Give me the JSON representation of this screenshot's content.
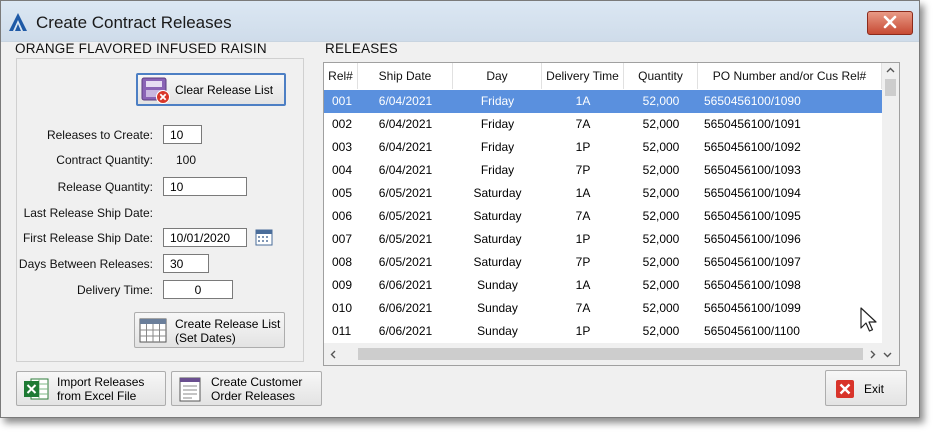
{
  "window": {
    "title": "Create Contract Releases",
    "colors": {
      "title_bg": "#d6e2ef",
      "close": "#c74a33",
      "selection": "#5a90de"
    }
  },
  "product": {
    "name": "ORANGE FLAVORED INFUSED RAISIN"
  },
  "left": {
    "clear_button": "Clear Release List",
    "fields": {
      "releases_to_create": {
        "label": "Releases to Create:",
        "value": "10"
      },
      "contract_quantity": {
        "label": "Contract Quantity:",
        "value": "100"
      },
      "release_quantity": {
        "label": "Release Quantity:",
        "value": "10"
      },
      "last_release_ship_date": {
        "label": "Last Release Ship Date:"
      },
      "first_release_ship_date": {
        "label": "First Release Ship Date:",
        "value": "10/01/2020"
      },
      "days_between_releases": {
        "label": "Days Between Releases:",
        "value": "30"
      },
      "delivery_time": {
        "label": "Delivery Time:",
        "value": "0"
      }
    },
    "create_release_button": {
      "line1": "Create Release List",
      "line2": "(Set Dates)"
    }
  },
  "releases": {
    "label": "RELEASES",
    "columns": [
      "Rel#",
      "Ship Date",
      "Day",
      "Delivery Time",
      "Quantity",
      "PO Number and/or Cus Rel#"
    ],
    "rows": [
      [
        "001",
        "6/04/2021",
        "Friday",
        "1A",
        "52,000",
        "5650456100/1090"
      ],
      [
        "002",
        "6/04/2021",
        "Friday",
        "7A",
        "52,000",
        "5650456100/1091"
      ],
      [
        "003",
        "6/04/2021",
        "Friday",
        "1P",
        "52,000",
        "5650456100/1092"
      ],
      [
        "004",
        "6/04/2021",
        "Friday",
        "7P",
        "52,000",
        "5650456100/1093"
      ],
      [
        "005",
        "6/05/2021",
        "Saturday",
        "1A",
        "52,000",
        "5650456100/1094"
      ],
      [
        "006",
        "6/05/2021",
        "Saturday",
        "7A",
        "52,000",
        "5650456100/1095"
      ],
      [
        "007",
        "6/05/2021",
        "Saturday",
        "1P",
        "52,000",
        "5650456100/1096"
      ],
      [
        "008",
        "6/05/2021",
        "Saturday",
        "7P",
        "52,000",
        "5650456100/1097"
      ],
      [
        "009",
        "6/06/2021",
        "Sunday",
        "1A",
        "52,000",
        "5650456100/1098"
      ],
      [
        "010",
        "6/06/2021",
        "Sunday",
        "7A",
        "52,000",
        "5650456100/1099"
      ],
      [
        "011",
        "6/06/2021",
        "Sunday",
        "1P",
        "52,000",
        "5650456100/1100"
      ]
    ],
    "selected_row": 0
  },
  "bottom": {
    "import_button": {
      "line1": "Import Releases",
      "line2": "from Excel File"
    },
    "create_orders_button": {
      "line1": "Create Customer",
      "line2": "Order Releases"
    },
    "exit_button": "Exit"
  }
}
